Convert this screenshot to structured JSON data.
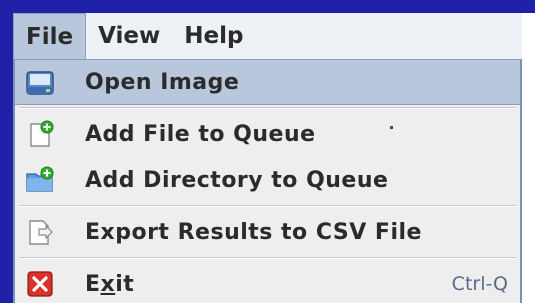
{
  "menubar": {
    "menus": [
      {
        "label": "File"
      },
      {
        "label": "View"
      },
      {
        "label": "Help"
      }
    ]
  },
  "file_menu": {
    "items": [
      {
        "label": "Open Image",
        "icon": "drive-icon"
      },
      {
        "label": "Add File to Queue",
        "icon": "add-file-icon"
      },
      {
        "label": "Add Directory to Queue",
        "icon": "add-folder-icon"
      },
      {
        "label": "Export Results to CSV File",
        "icon": "export-file-icon"
      },
      {
        "label_pre": "E",
        "label_mnemonic": "x",
        "label_post": "it",
        "accelerator": "Ctrl-Q",
        "icon": "exit-icon"
      }
    ]
  },
  "colors": {
    "window_edge": "#1f21a8",
    "selection": "#b9c7dc",
    "menu_bg": "#eeeeee",
    "exit_red": "#d8322c",
    "add_green": "#2fb02f"
  }
}
